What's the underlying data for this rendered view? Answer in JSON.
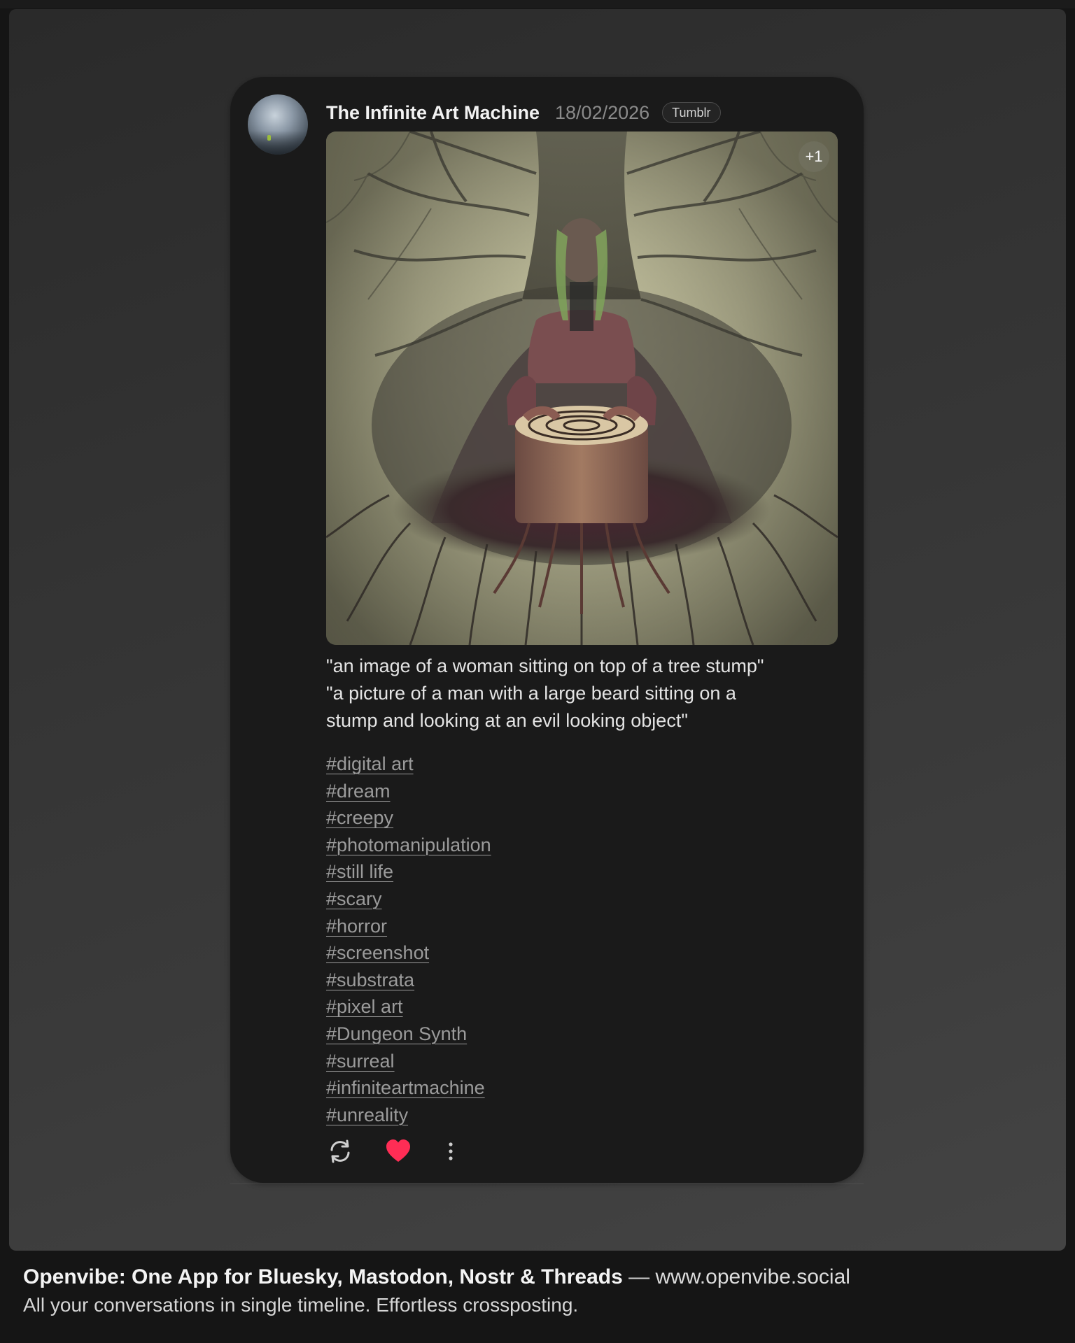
{
  "post": {
    "author": "The Infinite Art Machine",
    "date": "18/02/2026",
    "platform_badge": "Tumblr",
    "media": {
      "extra_count": "+1"
    },
    "caption_lines": [
      "\"an image of a woman sitting on top of a tree stump\"",
      "\"a picture of a man with a large beard sitting on a",
      "stump and looking at an evil looking object\""
    ],
    "tags": [
      "#digital art",
      "#dream",
      "#creepy",
      "#photomanipulation",
      "#still life",
      "#scary",
      "#horror",
      "#screenshot",
      "#substrata",
      "#pixel art",
      "#Dungeon Synth",
      "#surreal",
      "#infiniteartmachine",
      "#unreality"
    ],
    "actions": {
      "repost_icon": "repost-icon",
      "like_icon": "heart-icon",
      "more_icon": "more-vertical-icon",
      "like_color": "#ff2d55"
    }
  },
  "footer": {
    "title": "Openvibe: One App for Bluesky, Mastodon, Nostr & Threads",
    "separator": " — ",
    "url": "www.openvibe.social",
    "tagline": "All your conversations in single timeline. Effortless crossposting."
  }
}
